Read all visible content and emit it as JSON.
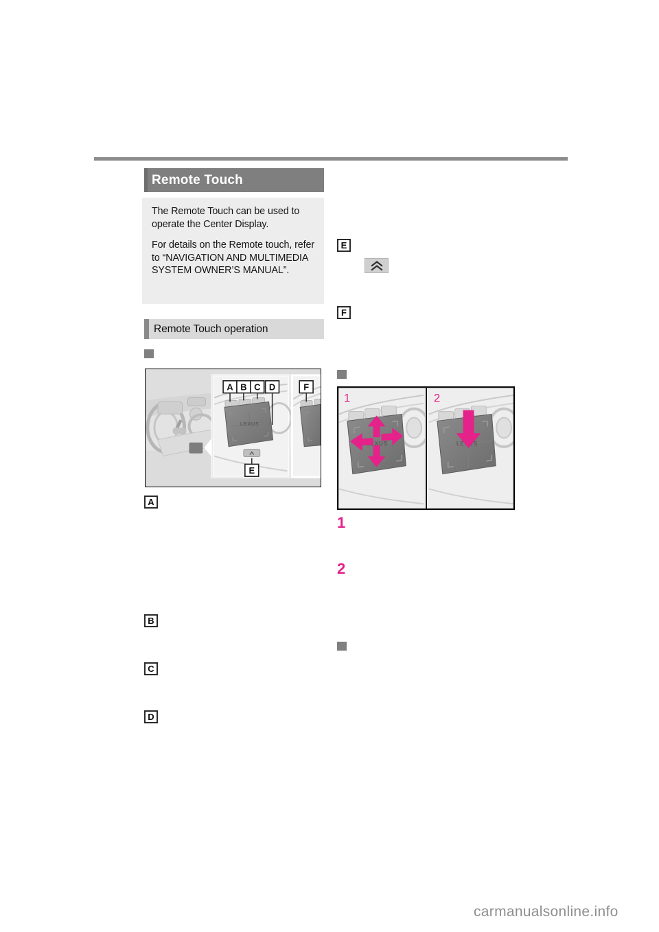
{
  "page": {
    "background_color": "#ffffff",
    "watermark": "carmanualsonline.info"
  },
  "section": {
    "title": "Remote Touch",
    "title_bar_color": "#7f7f7f",
    "title_text_color": "#ffffff"
  },
  "info_box": {
    "background_color": "#ededed",
    "paragraphs": [
      "The Remote Touch can be used to operate the Center Display.",
      "For details on the Remote touch, refer to “NAVIGATION AND MULTIMEDIA SYSTEM OWNER’S MANUAL”."
    ]
  },
  "subsection": {
    "title": "Remote Touch operation",
    "bar_color": "#d9d9d9",
    "accent_color": "#8a8a8a"
  },
  "bullets": {
    "bullet_color": "#808080",
    "items": [
      {
        "name": "bullet-components",
        "label": ""
      },
      {
        "name": "bullet-gestures",
        "label": ""
      },
      {
        "name": "bullet-notes",
        "label": ""
      }
    ]
  },
  "markers": {
    "letters": [
      "A",
      "B",
      "C",
      "D",
      "E",
      "F"
    ],
    "numbers": [
      "1",
      "2"
    ],
    "number_color": "#e5218a"
  },
  "figure_console": {
    "name": "remote-touch-console-illustration",
    "callouts_top": [
      "A",
      "B",
      "C",
      "D"
    ],
    "callout_right": "F",
    "callout_bottom": "E",
    "pad_logo": "LEXUS"
  },
  "figure_gestures": {
    "name": "remote-touch-gestures-illustration",
    "panels": [
      {
        "number": "1",
        "gesture": "slide-four-directions"
      },
      {
        "number": "2",
        "gesture": "press-down"
      }
    ],
    "arrow_color": "#e5218a"
  },
  "icons": {
    "chevron_up_double": "«"
  }
}
